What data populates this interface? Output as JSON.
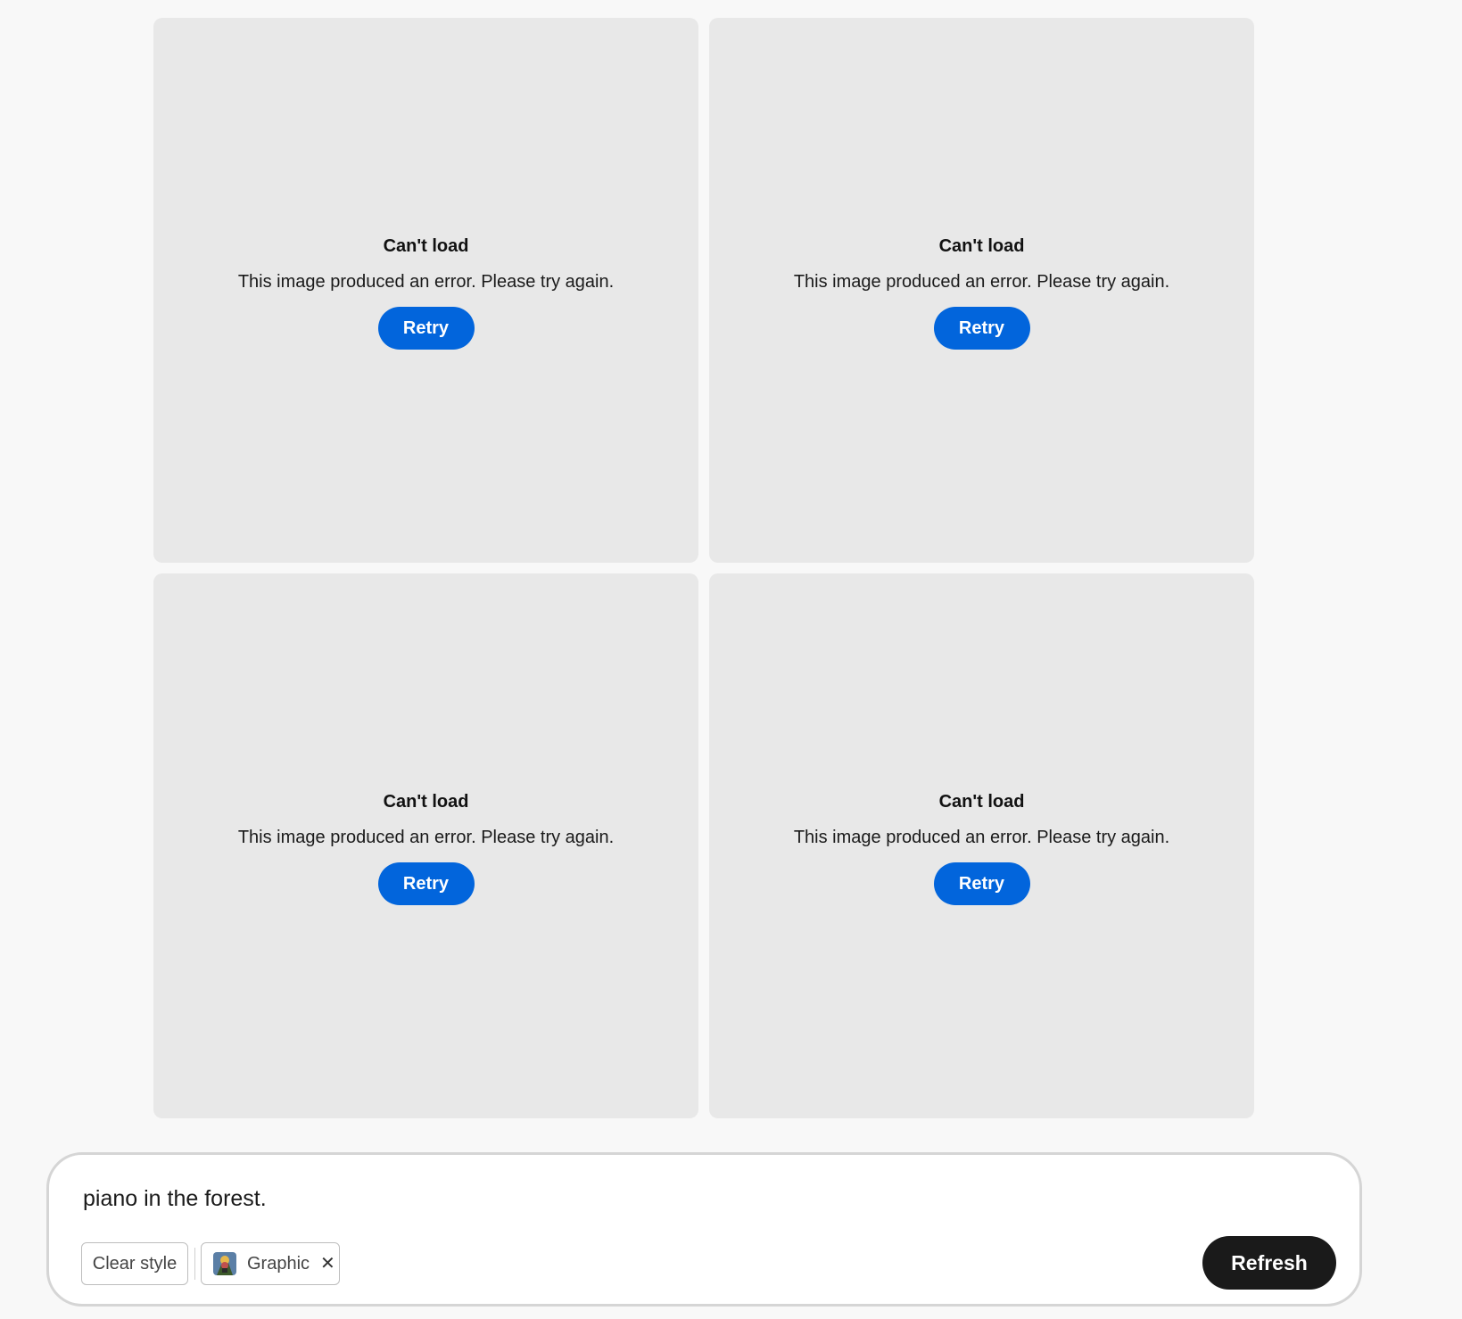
{
  "results": [
    {
      "title": "Can't load",
      "message": "This image produced an error. Please try again.",
      "retry_label": "Retry"
    },
    {
      "title": "Can't load",
      "message": "This image produced an error. Please try again.",
      "retry_label": "Retry"
    },
    {
      "title": "Can't load",
      "message": "This image produced an error. Please try again.",
      "retry_label": "Retry"
    },
    {
      "title": "Can't load",
      "message": "This image produced an error. Please try again.",
      "retry_label": "Retry"
    }
  ],
  "prompt": {
    "text": "piano in the forest.",
    "clear_style_label": "Clear style",
    "style_chip": {
      "label": "Graphic",
      "thumbnail_icon": "graphic-style-thumbnail",
      "remove_icon": "close-icon"
    },
    "refresh_label": "Refresh"
  },
  "colors": {
    "background": "#f8f8f8",
    "card": "#e8e8e8",
    "retry_button": "#0265dc",
    "refresh_button": "#1a1a1a"
  }
}
